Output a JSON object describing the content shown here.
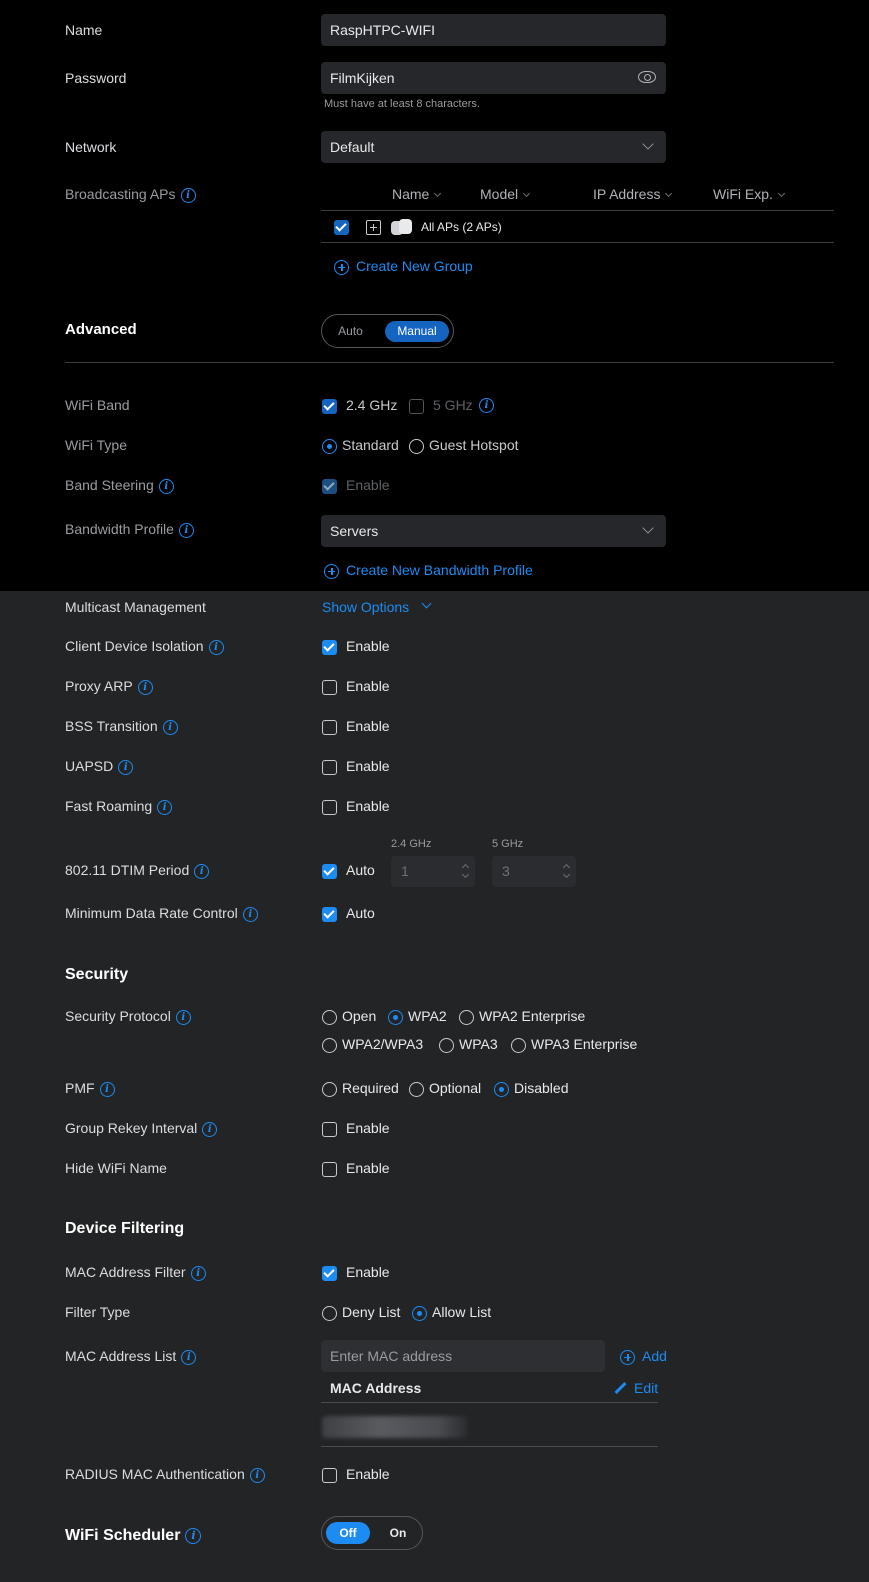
{
  "name": {
    "label": "Name",
    "value": "RaspHTPC-WIFI"
  },
  "password": {
    "label": "Password",
    "value": "FilmKijken",
    "hint": "Must have at least 8 characters."
  },
  "network": {
    "label": "Network",
    "value": "Default"
  },
  "broadcasting": {
    "label": "Broadcasting APs",
    "columns": [
      "Name",
      "Model",
      "IP Address",
      "WiFi Exp."
    ],
    "row_label": "All APs (2 APs)",
    "create_group": "Create New Group"
  },
  "advanced": {
    "label": "Advanced",
    "options": [
      "Auto",
      "Manual"
    ],
    "selected": "Manual"
  },
  "wifi_band": {
    "label": "WiFi Band",
    "opt1": "2.4 GHz",
    "opt2": "5 GHz"
  },
  "wifi_type": {
    "label": "WiFi Type",
    "opt1": "Standard",
    "opt2": "Guest Hotspot"
  },
  "band_steering": {
    "label": "Band Steering",
    "option": "Enable"
  },
  "bandwidth_profile": {
    "label": "Bandwidth Profile",
    "value": "Servers",
    "create": "Create New Bandwidth Profile"
  },
  "multicast": {
    "label": "Multicast Management",
    "link": "Show Options"
  },
  "options": [
    {
      "label": "Client Device Isolation",
      "value": "Enable",
      "checked": true
    },
    {
      "label": "Proxy ARP",
      "value": "Enable",
      "checked": false
    },
    {
      "label": "BSS Transition",
      "value": "Enable",
      "checked": false
    },
    {
      "label": "UAPSD",
      "value": "Enable",
      "checked": false
    },
    {
      "label": "Fast Roaming",
      "value": "Enable",
      "checked": false
    }
  ],
  "dtim": {
    "label": "802.11 DTIM Period",
    "auto": "Auto",
    "band1": "2.4 GHz",
    "band2": "5 GHz",
    "val1": "1",
    "val2": "3"
  },
  "min_rate": {
    "label": "Minimum Data Rate Control",
    "auto": "Auto"
  },
  "security": {
    "title": "Security",
    "protocol_label": "Security Protocol",
    "protocols": [
      "Open",
      "WPA2",
      "WPA2 Enterprise",
      "WPA2/WPA3",
      "WPA3",
      "WPA3 Enterprise"
    ],
    "protocol_selected": "WPA2",
    "pmf_label": "PMF",
    "pmf_options": [
      "Required",
      "Optional",
      "Disabled"
    ],
    "pmf_selected": "Disabled",
    "rekey_label": "Group Rekey Interval",
    "rekey_value": "Enable",
    "hide_label": "Hide WiFi Name",
    "hide_value": "Enable"
  },
  "device_filtering": {
    "title": "Device Filtering",
    "mac_filter_label": "MAC Address Filter",
    "mac_filter_value": "Enable",
    "filter_type_label": "Filter Type",
    "filter_types": [
      "Deny List",
      "Allow List"
    ],
    "filter_selected": "Allow List",
    "mac_list_label": "MAC Address List",
    "mac_placeholder": "Enter MAC address",
    "add": "Add",
    "mac_col": "MAC Address",
    "edit": "Edit",
    "radius_label": "RADIUS MAC Authentication",
    "radius_value": "Enable"
  },
  "scheduler": {
    "label": "WiFi Scheduler",
    "off": "Off",
    "on": "On",
    "selected": "Off"
  },
  "colors": {
    "accent": "#1c8cf2",
    "bg": "#232426",
    "top_bg": "#000000"
  }
}
